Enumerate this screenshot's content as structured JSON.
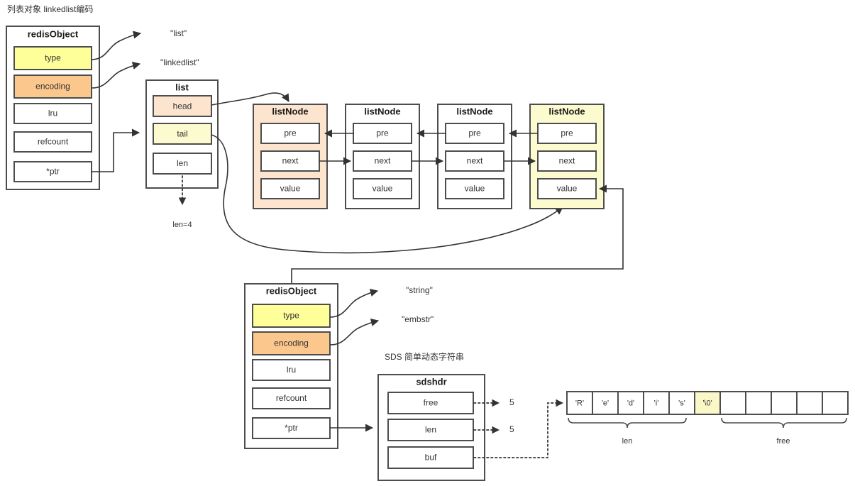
{
  "title": "列表对象 linkedlist编码",
  "colors": {
    "yellow": "#ffff99",
    "orange": "#fbc78d",
    "peach_fill": "#fce4cf",
    "light_yellow_fill": "#fcfacf",
    "pale_yellow_cell": "#fbf8c8",
    "stroke": "#4d4d4d",
    "line": "#333333",
    "text": "#333333"
  },
  "top_object": {
    "title": "redisObject",
    "fields": [
      {
        "label": "type",
        "fill": "yellow"
      },
      {
        "label": "encoding",
        "fill": "orange"
      },
      {
        "label": "lru",
        "fill": "white"
      },
      {
        "label": "refcount",
        "fill": "white"
      },
      {
        "label": "*ptr",
        "fill": "white"
      }
    ],
    "type_value": "\"list\"",
    "encoding_value": "\"linkedlist\""
  },
  "list_struct": {
    "title": "list",
    "fields": [
      {
        "label": "head",
        "fill": "peach_fill"
      },
      {
        "label": "tail",
        "fill": "light_yellow_fill"
      },
      {
        "label": "len",
        "fill": "white"
      }
    ],
    "len_note": "len=4"
  },
  "nodes": [
    {
      "title": "listNode",
      "fill": "peach_fill",
      "fields": [
        "pre",
        "next",
        "value"
      ]
    },
    {
      "title": "listNode",
      "fill": "white",
      "fields": [
        "pre",
        "next",
        "value"
      ]
    },
    {
      "title": "listNode",
      "fill": "white",
      "fields": [
        "pre",
        "next",
        "value"
      ]
    },
    {
      "title": "listNode",
      "fill": "light_yellow_fill",
      "fields": [
        "pre",
        "next",
        "value"
      ]
    }
  ],
  "bottom_object": {
    "title": "redisObject",
    "fields": [
      {
        "label": "type",
        "fill": "yellow"
      },
      {
        "label": "encoding",
        "fill": "orange"
      },
      {
        "label": "lru",
        "fill": "white"
      },
      {
        "label": "refcount",
        "fill": "white"
      },
      {
        "label": "*ptr",
        "fill": "white"
      }
    ],
    "type_value": "\"string\"",
    "encoding_value": "\"embstr\""
  },
  "sds": {
    "caption": "SDS 简单动态字符串",
    "title": "sdshdr",
    "fields": [
      {
        "label": "free",
        "value": "5"
      },
      {
        "label": "len",
        "value": "5"
      },
      {
        "label": "buf",
        "value": ""
      }
    ]
  },
  "buffer": {
    "cells": [
      {
        "text": "'R'",
        "highlight": false
      },
      {
        "text": "'e'",
        "highlight": false
      },
      {
        "text": "'d'",
        "highlight": false
      },
      {
        "text": "'i'",
        "highlight": false
      },
      {
        "text": "'s'",
        "highlight": false
      },
      {
        "text": "'\\0'",
        "highlight": true
      },
      {
        "text": "",
        "highlight": false
      },
      {
        "text": "",
        "highlight": false
      },
      {
        "text": "",
        "highlight": false
      },
      {
        "text": "",
        "highlight": false
      },
      {
        "text": "",
        "highlight": false
      }
    ],
    "brace_len_label": "len",
    "brace_free_label": "free"
  }
}
